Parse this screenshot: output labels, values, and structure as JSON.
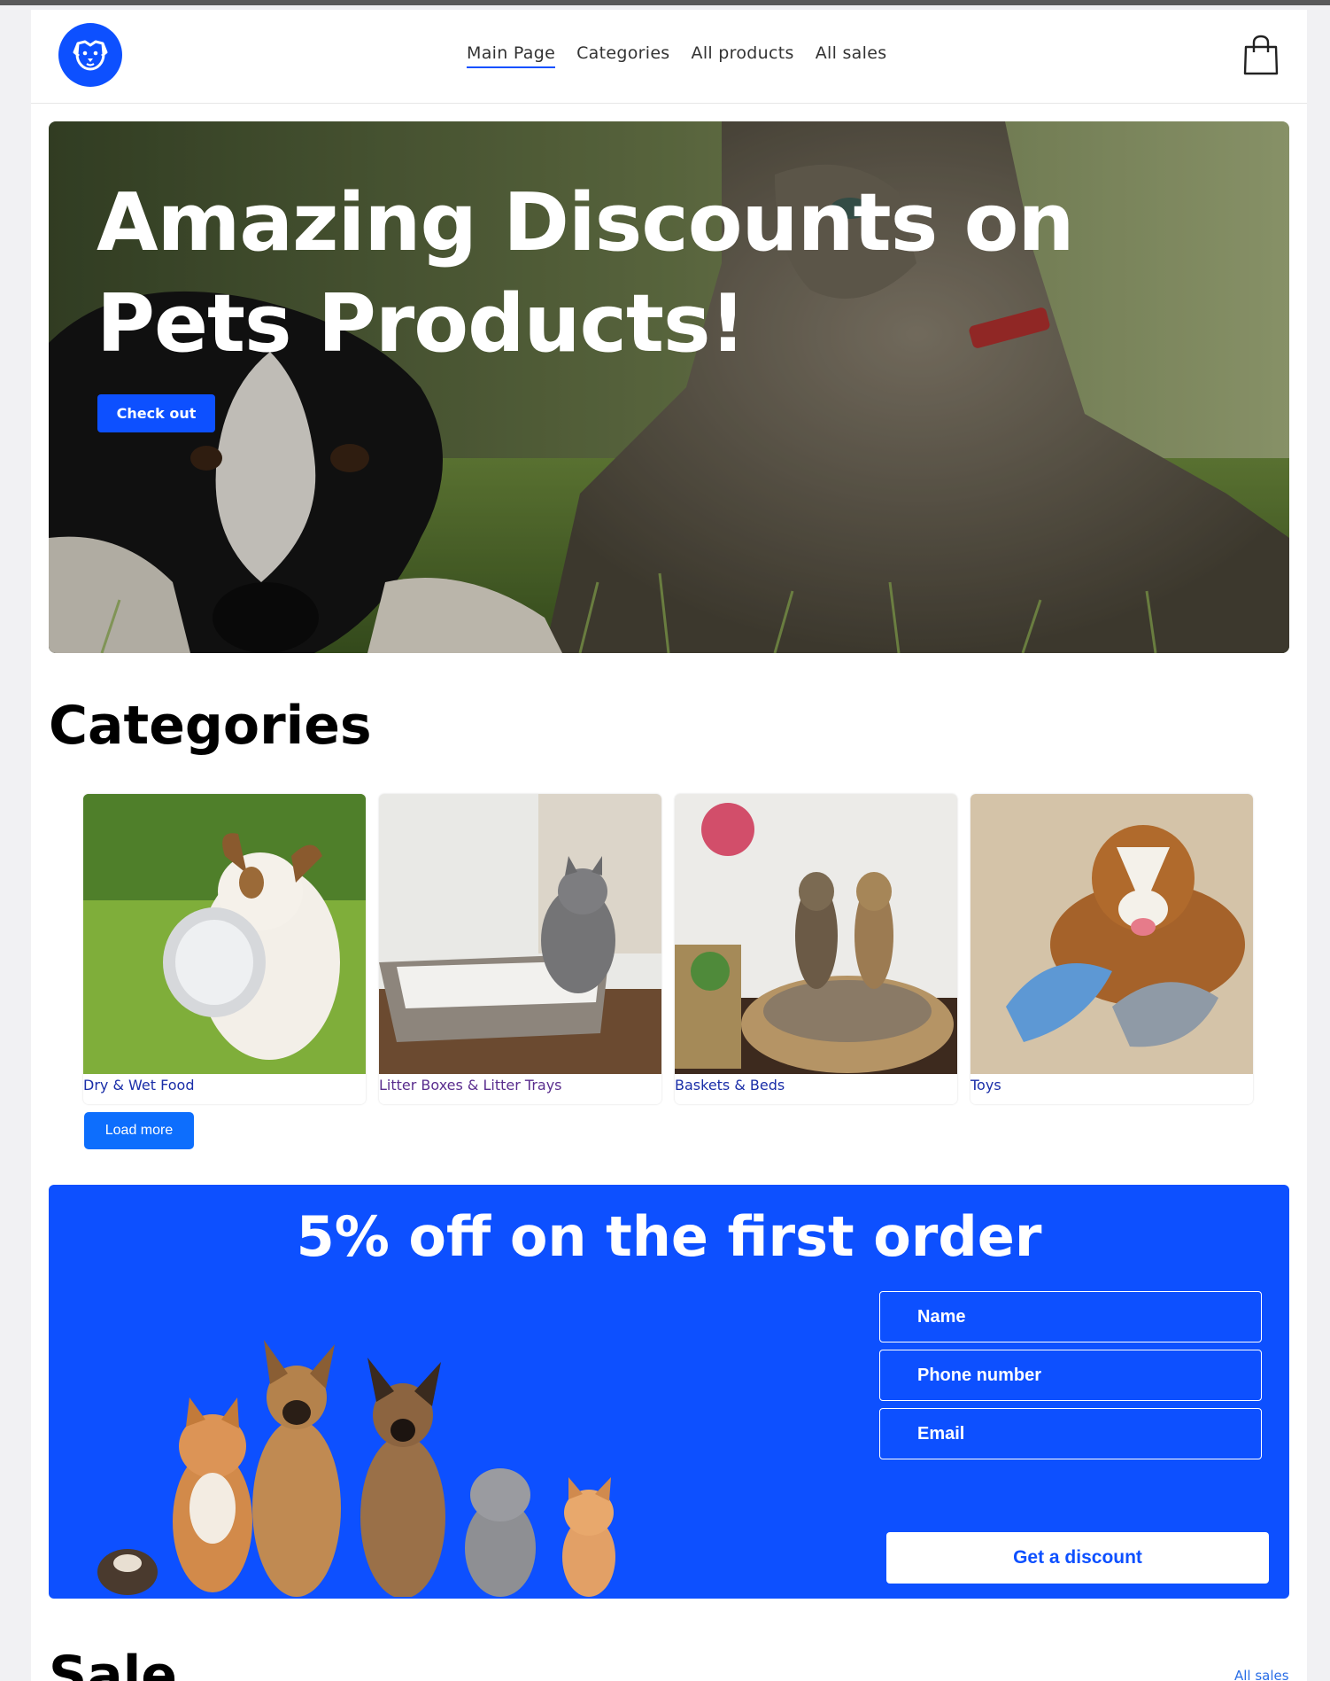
{
  "header": {
    "nav": {
      "main_page": "Main Page",
      "categories": "Categories",
      "all_products": "All products",
      "all_sales": "All sales"
    },
    "logo_icon": "dog-face-icon",
    "cart_icon": "shopping-bag-icon"
  },
  "hero": {
    "title": "Amazing Discounts on Pets Products!",
    "button": "Check out"
  },
  "categories": {
    "title": "Categories",
    "items": [
      {
        "label": "Dry & Wet Food"
      },
      {
        "label": "Litter Boxes & Litter Trays"
      },
      {
        "label": "Baskets & Beds"
      },
      {
        "label": "Toys"
      }
    ],
    "load_more": "Load more"
  },
  "discount": {
    "title": "5% off on the first order",
    "name_placeholder": "Name",
    "phone_placeholder": "Phone number",
    "email_placeholder": "Email",
    "button": "Get a discount"
  },
  "sale": {
    "title": "Sale",
    "all_sales": "All sales"
  },
  "colors": {
    "brand_blue": "#0d50ff",
    "load_more_blue": "#0d6efd",
    "link_blue": "#1a2ea8"
  }
}
